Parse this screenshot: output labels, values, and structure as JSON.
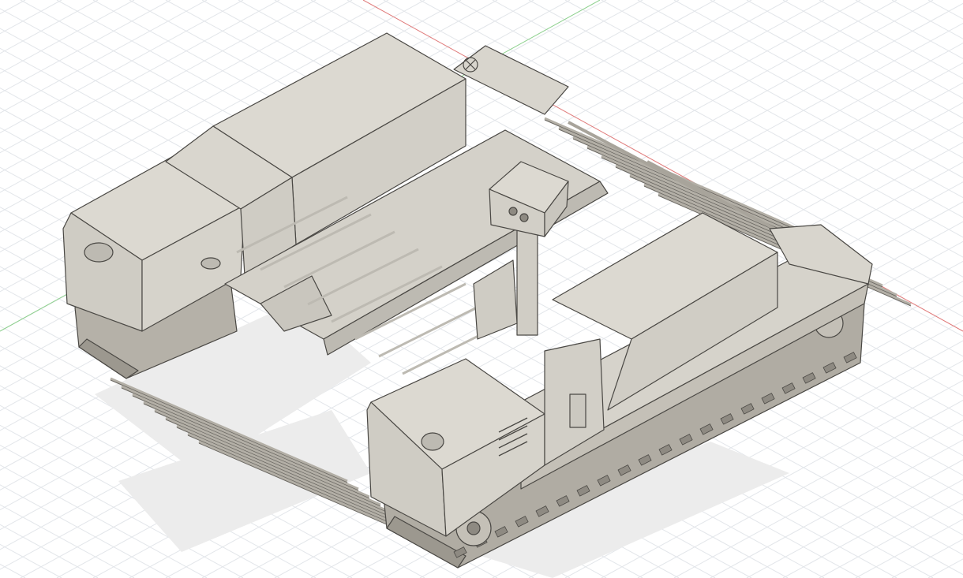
{
  "viewport": {
    "kind": "3D CAD viewport",
    "background": "#ffffff",
    "grid_color": "#e3e6ea",
    "axis_x_color": "#e07a7a",
    "axis_y_color": "#8fd18f",
    "origin_marker": "origin-icon"
  },
  "model": {
    "subject": "tracked vehicle",
    "body_color": "#d6d3cb",
    "top_color": "#dcd9d1",
    "shadow_color": "#bdbab2",
    "outline_color": "#4a4844",
    "track_color": "#a9a59c",
    "floor_shadow": "#e9e9e9"
  }
}
